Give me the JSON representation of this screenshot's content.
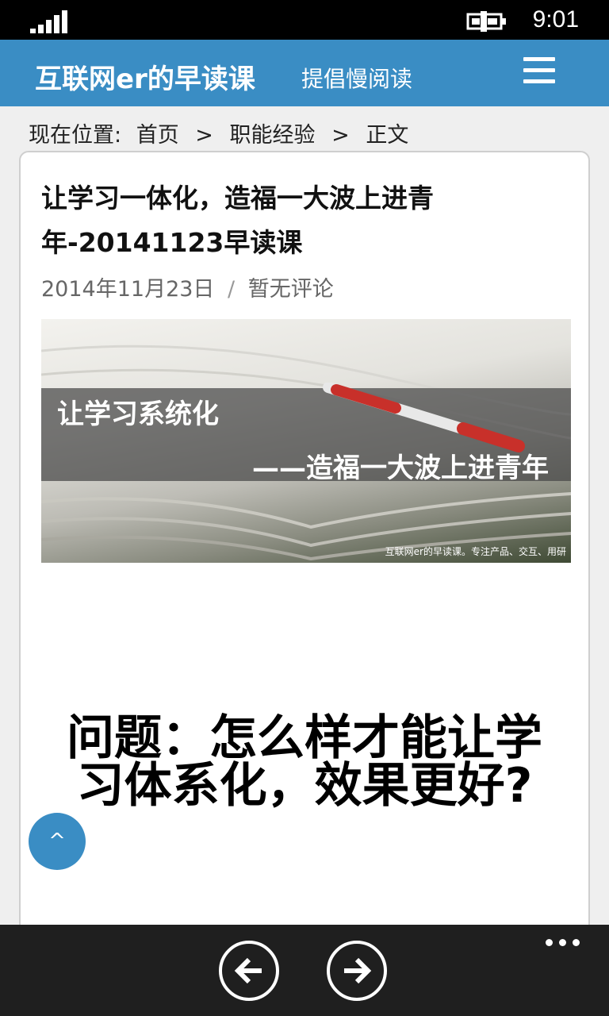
{
  "status_bar": {
    "time": "9:01",
    "icons": [
      "signal-icon",
      "battery-charging-icon"
    ]
  },
  "header": {
    "site_title": "互联网er的早读课",
    "tagline": "提倡慢阅读",
    "menu_icon": "hamburger-menu-icon"
  },
  "breadcrumb": {
    "prefix": "现在位置:",
    "home": "首页",
    "separator": ">",
    "category": "职能经验",
    "current": "正文"
  },
  "post": {
    "title": "让学习一体化，造福一大波上进青年-20141123早读课",
    "date": "2014年11月23日",
    "meta_separator": "/",
    "comments": "暂无评论",
    "hero": {
      "line1": "让学习系统化",
      "line2": "——造福一大波上进青年",
      "credit": "互联网er的早读课。专注产品、交互、用研"
    },
    "question": "问题：怎么样才能让学习体系化，效果更好?"
  },
  "back_to_top": {
    "label": "^",
    "icon": "arrow-up-icon"
  },
  "app_bar": {
    "icons": [
      "back-arrow-icon",
      "forward-arrow-icon",
      "more-ellipsis-icon"
    ]
  },
  "colors": {
    "brand": "#3a8dc4",
    "status_bar": "#000000",
    "app_bar": "#1f1f1f"
  }
}
